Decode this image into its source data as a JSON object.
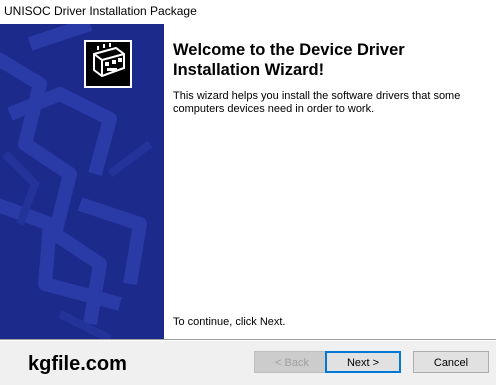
{
  "window": {
    "title": "UNISOC Driver Installation Package"
  },
  "main": {
    "heading": "Welcome to the Device Driver Installation Wizard!",
    "description": "This wizard helps you install the software drivers that some computers devices need in order to work.",
    "continue_text": "To continue, click Next."
  },
  "footer": {
    "watermark": "kgfile.com",
    "back_label": "< Back",
    "next_label": "Next >",
    "cancel_label": "Cancel"
  },
  "colors": {
    "banner": "#1c2a8c",
    "banner_shape": "#2a3aa6",
    "accent_border": "#0078d7"
  },
  "icons": {
    "hardware": "hardware-card-icon"
  }
}
